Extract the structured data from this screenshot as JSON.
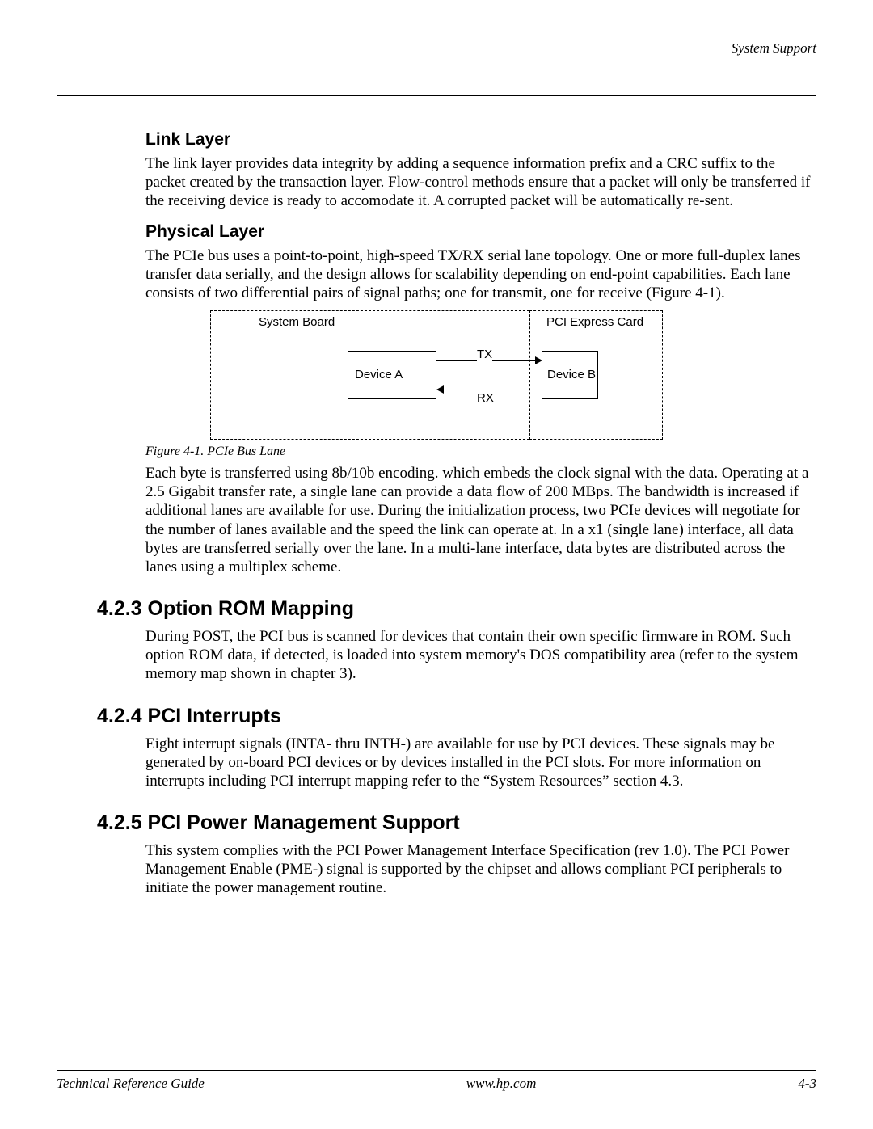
{
  "header": {
    "right": "System Support"
  },
  "sections": {
    "link_layer": {
      "title": "Link Layer",
      "body": "The link layer provides data integrity by adding a sequence information prefix and a CRC suffix to the packet created by the transaction layer. Flow-control methods ensure that a packet will only be transferred if the receiving device is ready to accomodate it. A corrupted packet will be automatically re-sent."
    },
    "physical_layer": {
      "title": "Physical Layer",
      "intro": "The PCIe bus uses a point-to-point, high-speed TX/RX serial lane topology. One or more full-duplex lanes transfer data serially, and the design allows for scalability depending on end-point capabilities. Each lane consists of two differential pairs of signal paths; one for transmit, one for receive (Figure 4-1).",
      "caption": "Figure 4-1. PCIe Bus Lane",
      "after": "Each byte is transferred using 8b/10b encoding. which embeds the clock signal with the data. Operating at a 2.5 Gigabit transfer rate, a single lane can provide a data flow of 200 MBps. The bandwidth is increased if additional lanes are available for use. During the initialization process, two PCIe devices will negotiate for the number of lanes available and the speed the link can operate at. In a x1 (single lane) interface, all data bytes are transferred serially over the lane. In a multi-lane interface, data bytes are distributed across the lanes using a multiplex scheme."
    },
    "opt_rom": {
      "title": "4.2.3 Option ROM Mapping",
      "body": "During POST,  the PCI bus is scanned for devices that contain their own specific firmware in ROM. Such option ROM data, if detected, is loaded into system memory's DOS compatibility area (refer to the system memory map shown in chapter 3)."
    },
    "pci_int": {
      "title": "4.2.4 PCI Interrupts",
      "body": "Eight interrupt signals (INTA- thru INTH-) are available for use by PCI devices. These signals may be generated by on-board PCI devices or by devices installed in the PCI slots. For more information on interrupts including PCI interrupt mapping refer to the “System Resources” section 4.3."
    },
    "pci_pm": {
      "title": "4.2.5 PCI Power Management Support",
      "body": "This system complies with the PCI Power Management Interface Specification (rev 1.0). The PCI Power Management Enable (PME-) signal is supported by the chipset and allows compliant PCI peripherals to initiate the power management routine."
    }
  },
  "diagram": {
    "left_label": "System Board",
    "right_label": "PCI Express Card",
    "device_a": "Device A",
    "device_b": "Device B",
    "tx": "TX",
    "rx": "RX"
  },
  "footer": {
    "left": "Technical Reference Guide",
    "center": "www.hp.com",
    "right": "4-3"
  }
}
